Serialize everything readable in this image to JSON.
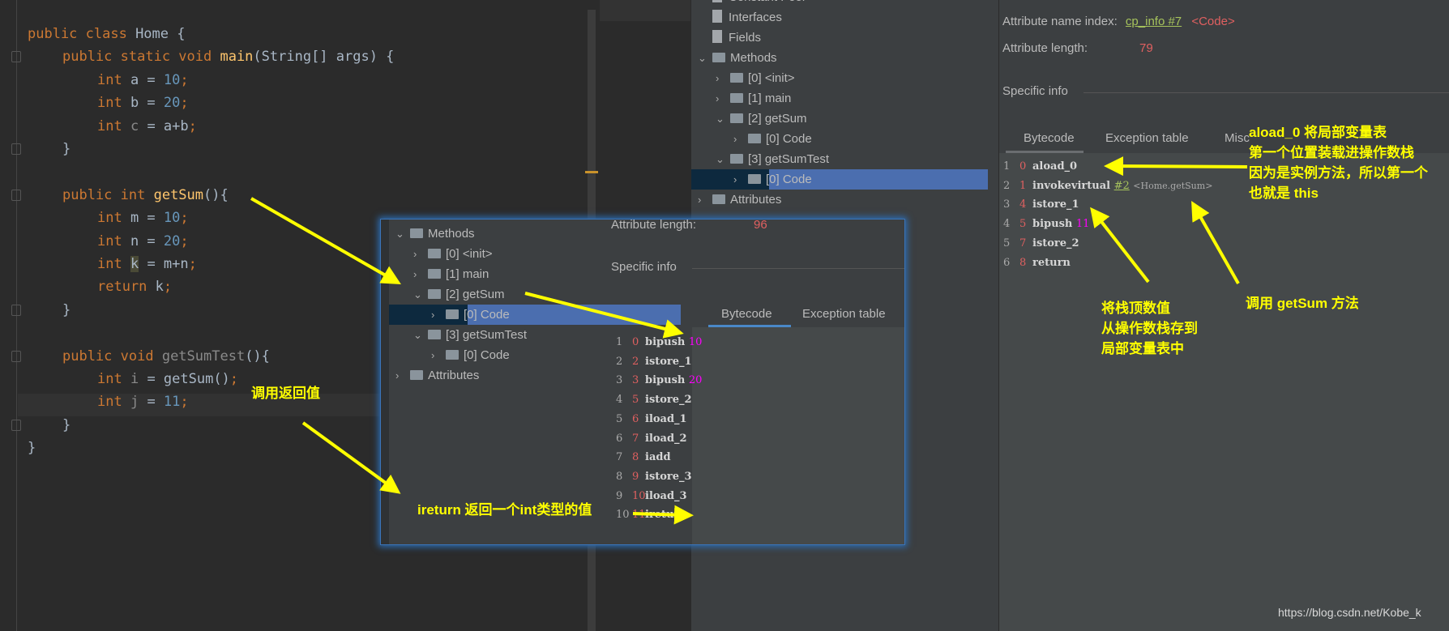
{
  "editor": {
    "lines": [
      {
        "indent": 0,
        "tokens": [
          [
            "public class ",
            "kw"
          ],
          [
            "Home {",
            "txt"
          ]
        ]
      },
      {
        "indent": 1,
        "tokens": [
          [
            "public static void ",
            "kw"
          ],
          [
            "main",
            "fn"
          ],
          [
            "(String[] args) {",
            "txt"
          ]
        ]
      },
      {
        "indent": 2,
        "tokens": [
          [
            "int ",
            "kw"
          ],
          [
            "a = ",
            "txt"
          ],
          [
            "10",
            "num"
          ],
          [
            ";",
            "kw"
          ]
        ]
      },
      {
        "indent": 2,
        "tokens": [
          [
            "int ",
            "kw"
          ],
          [
            "b = ",
            "txt"
          ],
          [
            "20",
            "num"
          ],
          [
            ";",
            "kw"
          ]
        ]
      },
      {
        "indent": 2,
        "tokens": [
          [
            "int ",
            "kw"
          ],
          [
            "c",
            "dim"
          ],
          [
            " = a+b",
            ""
          ],
          [
            ";",
            "kw"
          ]
        ]
      },
      {
        "indent": 1,
        "tokens": [
          [
            "}",
            "txt"
          ]
        ]
      },
      {
        "indent": 0,
        "tokens": []
      },
      {
        "indent": 1,
        "tokens": [
          [
            "public int ",
            "kw"
          ],
          [
            "getSum",
            "fn"
          ],
          [
            "(){",
            "txt"
          ]
        ]
      },
      {
        "indent": 2,
        "tokens": [
          [
            "int ",
            "kw"
          ],
          [
            "m = ",
            "txt"
          ],
          [
            "10",
            "num"
          ],
          [
            ";",
            "kw"
          ]
        ]
      },
      {
        "indent": 2,
        "tokens": [
          [
            "int ",
            "kw"
          ],
          [
            "n = ",
            "txt"
          ],
          [
            "20",
            "num"
          ],
          [
            ";",
            "kw"
          ]
        ]
      },
      {
        "indent": 2,
        "tokens": [
          [
            "int ",
            "kw"
          ],
          [
            "k",
            "hl"
          ],
          [
            " = m+n",
            ""
          ],
          [
            ";",
            "kw"
          ]
        ]
      },
      {
        "indent": 2,
        "tokens": [
          [
            "return ",
            "kw"
          ],
          [
            "k",
            ""
          ],
          [
            ";",
            "kw"
          ]
        ]
      },
      {
        "indent": 1,
        "tokens": [
          [
            "}",
            "txt"
          ]
        ]
      },
      {
        "indent": 0,
        "tokens": []
      },
      {
        "indent": 1,
        "tokens": [
          [
            "public void ",
            "kw"
          ],
          [
            "getSumTest",
            "dim"
          ],
          [
            "(){",
            "txt"
          ]
        ]
      },
      {
        "indent": 2,
        "tokens": [
          [
            "int ",
            "kw"
          ],
          [
            "i",
            "dim"
          ],
          [
            " = getSum()",
            ""
          ],
          [
            ";",
            "kw"
          ]
        ]
      },
      {
        "indent": 2,
        "tokens": [
          [
            "int ",
            "kw"
          ],
          [
            "j",
            "dim"
          ],
          [
            " = ",
            ""
          ],
          [
            "11",
            "num"
          ],
          [
            ";",
            "kw"
          ]
        ]
      },
      {
        "indent": 1,
        "tokens": [
          [
            "}",
            "txt"
          ]
        ]
      },
      {
        "indent": 0,
        "tokens": [
          [
            "}",
            "txt"
          ]
        ]
      }
    ]
  },
  "tree": {
    "items": [
      {
        "label": "Constant Pool",
        "depth": 0,
        "arrow": "",
        "icon": "file"
      },
      {
        "label": "Interfaces",
        "depth": 0,
        "arrow": "",
        "icon": "file"
      },
      {
        "label": "Fields",
        "depth": 0,
        "arrow": "",
        "icon": "file"
      },
      {
        "label": "Methods",
        "depth": 0,
        "arrow": "⌄",
        "icon": "folder"
      },
      {
        "label": "[0] <init>",
        "depth": 1,
        "arrow": "›",
        "icon": "folder"
      },
      {
        "label": "[1] main",
        "depth": 1,
        "arrow": "›",
        "icon": "folder"
      },
      {
        "label": "[2] getSum",
        "depth": 1,
        "arrow": "⌄",
        "icon": "folder"
      },
      {
        "label": "[0] Code",
        "depth": 2,
        "arrow": "›",
        "icon": "folder"
      },
      {
        "label": "[3] getSumTest",
        "depth": 1,
        "arrow": "⌄",
        "icon": "folder"
      },
      {
        "label": "[0] Code",
        "depth": 2,
        "arrow": "›",
        "icon": "folder",
        "selected": true
      },
      {
        "label": "Attributes",
        "depth": 0,
        "arrow": "›",
        "icon": "folder"
      }
    ]
  },
  "right": {
    "attr_name_label": "Attribute name index:",
    "attr_name_link": "cp_info #7",
    "attr_name_value": "<Code>",
    "attr_len_label": "Attribute length:",
    "attr_len_value": "79",
    "specific_info": "Specific info",
    "tabs": [
      "Bytecode",
      "Exception table",
      "Misc"
    ],
    "bytecode": [
      {
        "ln": "1",
        "off": "0",
        "op": "aload_0"
      },
      {
        "ln": "2",
        "off": "1",
        "op": "invokevirtual",
        "ref": "#2",
        "comment": "<Home.getSum>"
      },
      {
        "ln": "3",
        "off": "4",
        "op": "istore_1"
      },
      {
        "ln": "4",
        "off": "5",
        "op": "bipush",
        "arg": "11"
      },
      {
        "ln": "5",
        "off": "7",
        "op": "istore_2"
      },
      {
        "ln": "6",
        "off": "8",
        "op": "return"
      }
    ]
  },
  "overlay": {
    "tree": [
      {
        "label": "Methods",
        "depth": 0,
        "arrow": "⌄"
      },
      {
        "label": "[0] <init>",
        "depth": 1,
        "arrow": "›"
      },
      {
        "label": "[1] main",
        "depth": 1,
        "arrow": "›"
      },
      {
        "label": "[2] getSum",
        "depth": 1,
        "arrow": "⌄"
      },
      {
        "label": "[0] Code",
        "depth": 2,
        "arrow": "›",
        "selected": true
      },
      {
        "label": "[3] getSumTest",
        "depth": 1,
        "arrow": "⌄"
      },
      {
        "label": "[0] Code",
        "depth": 2,
        "arrow": "›"
      },
      {
        "label": "Attributes",
        "depth": 0,
        "arrow": "›"
      }
    ],
    "attr_len_label": "Attribute length:",
    "attr_len_value": "96",
    "specific_info": "Specific info",
    "tabs": [
      "Bytecode",
      "Exception table"
    ],
    "bytecode": [
      {
        "ln": "1",
        "off": "0",
        "op": "bipush",
        "arg": "10"
      },
      {
        "ln": "2",
        "off": "2",
        "op": "istore_1"
      },
      {
        "ln": "3",
        "off": "3",
        "op": "bipush",
        "arg": "20"
      },
      {
        "ln": "4",
        "off": "5",
        "op": "istore_2"
      },
      {
        "ln": "5",
        "off": "6",
        "op": "iload_1"
      },
      {
        "ln": "6",
        "off": "7",
        "op": "iload_2"
      },
      {
        "ln": "7",
        "off": "8",
        "op": "iadd"
      },
      {
        "ln": "8",
        "off": "9",
        "op": "istore_3"
      },
      {
        "ln": "9",
        "off": "10",
        "op": "iload_3"
      },
      {
        "ln": "10",
        "off": "11",
        "op": "ireturn"
      }
    ]
  },
  "annotations": {
    "call_return": "调用返回值",
    "ireturn": "ireturn 返回一个int类型的值",
    "aload": [
      "aload_0 将局部变量表",
      "第一个位置装载进操作数栈",
      "因为是实例方法，所以第一个",
      "也就是 this"
    ],
    "istore": [
      "将栈顶数值",
      "从操作数栈存到",
      "局部变量表中"
    ],
    "invoke": "调用 getSum 方法"
  },
  "watermark": "https://blog.csdn.net/Kobe_k",
  "colors": {
    "annotation": "#ffff00",
    "keyword": "#cc7832",
    "selection": "#4b6eaf"
  }
}
